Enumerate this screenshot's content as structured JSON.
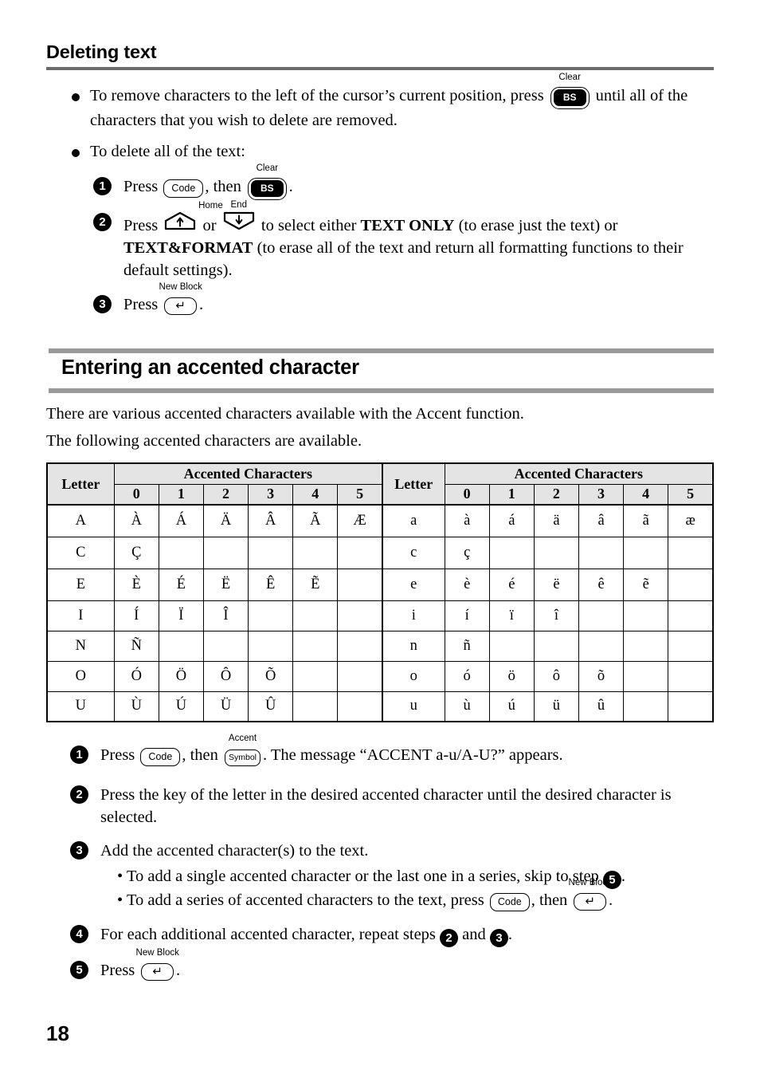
{
  "page": {
    "number": "18"
  },
  "section_deleting": {
    "heading": "Deleting text",
    "bullets": [
      {
        "text_before": "To remove characters to the left of the cursor’s current position, press",
        "key": {
          "label_above": "Clear",
          "face": "BS"
        },
        "text_after": "until all of the characters that you wish to delete are removed."
      },
      {
        "text_before": "To delete all of the text:",
        "key": null,
        "text_after": ""
      }
    ],
    "steps": [
      {
        "num": "1",
        "seg1": "Press",
        "key1": {
          "label_above": "",
          "face": "Code"
        },
        "seg2": ", then",
        "key2": {
          "label_above": "Clear",
          "face": "BS"
        },
        "seg3": "."
      },
      {
        "num": "2",
        "seg1": "Press",
        "key1": {
          "label_above": "Home",
          "face": "↑"
        },
        "seg2": "or",
        "key2": {
          "label_above": "End",
          "face": "↓"
        },
        "seg3": "to select either",
        "bold1": "TEXT ONLY",
        "seg4": "(to erase just the text) or",
        "bold2": "TEXT&FORMAT",
        "seg5": "(to erase all of the text and return all formatting functions to their default settings)."
      },
      {
        "num": "3",
        "seg1": "Press",
        "key1": {
          "label_above": "New Block",
          "face": "↵"
        },
        "seg2": "."
      }
    ]
  },
  "section_accent": {
    "heading": "Entering an accented character",
    "intro_line1": "There are various accented characters available with the Accent function.",
    "intro_line2": "The following accented characters are available.",
    "table": {
      "header_letter": "Letter",
      "header_group": "Accented Characters",
      "columns": [
        "0",
        "1",
        "2",
        "3",
        "4",
        "5"
      ],
      "rows_upper": [
        {
          "letter": "A",
          "chars": [
            "À",
            "Á",
            "Ä",
            "Â",
            "Ã",
            "Æ"
          ]
        },
        {
          "letter": "C",
          "chars": [
            "Ç",
            "",
            "",
            "",
            "",
            ""
          ]
        },
        {
          "letter": "E",
          "chars": [
            "È",
            "É",
            "Ë",
            "Ê",
            "Ẽ",
            ""
          ]
        },
        {
          "letter": "I",
          "chars": [
            "Í",
            "Ï",
            "Î",
            "",
            "",
            ""
          ]
        },
        {
          "letter": "N",
          "chars": [
            "Ñ",
            "",
            "",
            "",
            "",
            ""
          ]
        },
        {
          "letter": "O",
          "chars": [
            "Ó",
            "Ö",
            "Ô",
            "Õ",
            "",
            ""
          ]
        },
        {
          "letter": "U",
          "chars": [
            "Ù",
            "Ú",
            "Ü",
            "Û",
            "",
            ""
          ]
        }
      ],
      "rows_lower": [
        {
          "letter": "a",
          "chars": [
            "à",
            "á",
            "ä",
            "â",
            "ã",
            "æ"
          ]
        },
        {
          "letter": "c",
          "chars": [
            "ç",
            "",
            "",
            "",
            "",
            ""
          ]
        },
        {
          "letter": "e",
          "chars": [
            "è",
            "é",
            "ë",
            "ê",
            "ẽ",
            ""
          ]
        },
        {
          "letter": "i",
          "chars": [
            "í",
            "ï",
            "î",
            "",
            "",
            ""
          ]
        },
        {
          "letter": "n",
          "chars": [
            "ñ",
            "",
            "",
            "",
            "",
            ""
          ]
        },
        {
          "letter": "o",
          "chars": [
            "ó",
            "ö",
            "ô",
            "õ",
            "",
            ""
          ]
        },
        {
          "letter": "u",
          "chars": [
            "ù",
            "ú",
            "ü",
            "û",
            "",
            ""
          ]
        }
      ]
    },
    "steps": [
      {
        "num": "1",
        "seg1": "Press",
        "key1": {
          "label_above": "",
          "face": "Code"
        },
        "seg2": ", then",
        "key2": {
          "label_above": "Accent",
          "face": "Symbol"
        },
        "seg3": ". The message “ACCENT a-u/A-U?” appears."
      },
      {
        "num": "2",
        "seg1": "Press the key of the letter in the desired accented character until the desired character is selected."
      },
      {
        "num": "3",
        "seg1": "Add the accented character(s) to the text.",
        "sub_bullets": [
          {
            "text_before": "To add a single accented character or the last one in a series, skip to step",
            "step_ref": "5",
            "text_after": "."
          },
          {
            "text_before": "To add a series of accented characters to the text, press",
            "key1": {
              "label_above": "",
              "face": "Code"
            },
            "mid": ", then",
            "key2": {
              "label_above": "New Block",
              "face": "↵"
            },
            "text_after": "."
          }
        ]
      },
      {
        "num": "4",
        "seg1": "For each additional accented character, repeat steps",
        "ref1": "2",
        "seg2": "and",
        "ref2": "3",
        "seg3": "."
      },
      {
        "num": "5",
        "seg1": "Press",
        "key1": {
          "label_above": "New Block",
          "face": "↵"
        },
        "seg2": "."
      }
    ]
  },
  "colors": {
    "rule_gray": "#6b6b6b",
    "section_bar_gray": "#9a9a9a",
    "table_header_bg": "#e4e4e4",
    "text": "#000000"
  }
}
